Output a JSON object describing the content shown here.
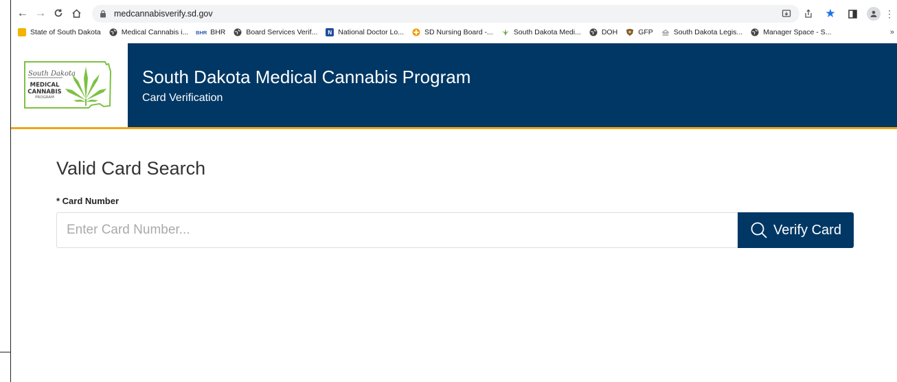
{
  "browser": {
    "url": "medcannabisverify.sd.gov",
    "bookmarks": [
      {
        "label": "State of South Dakota",
        "icon": "sd-flag-icon",
        "color": "#f2b400"
      },
      {
        "label": "Medical Cannabis i...",
        "icon": "globe-icon",
        "color": "#444444"
      },
      {
        "label": "BHR",
        "icon": "bhr-icon",
        "color": "#2a5aa8",
        "fav_text": "BHR"
      },
      {
        "label": "Board Services Verif...",
        "icon": "globe-icon",
        "color": "#444444"
      },
      {
        "label": "National Doctor Lo...",
        "icon": "n-logo-icon",
        "color": "#1f4e9c",
        "fav_text": "N"
      },
      {
        "label": "SD Nursing Board -...",
        "icon": "nursing-icon",
        "color": "#f29a00"
      },
      {
        "label": "South Dakota Medi...",
        "icon": "leaf-icon",
        "color": "#6aa84f"
      },
      {
        "label": "DOH",
        "icon": "globe-icon",
        "color": "#444444"
      },
      {
        "label": "GFP",
        "icon": "gfp-icon",
        "color": "#7a5c2e"
      },
      {
        "label": "South Dakota Legis...",
        "icon": "capitol-icon",
        "color": "#888888"
      },
      {
        "label": "Manager Space - S...",
        "icon": "globe-icon",
        "color": "#444444"
      }
    ],
    "more": "»"
  },
  "header": {
    "logo_script": "South Dakota",
    "logo_line1": "MEDICAL",
    "logo_line2": "CANNABIS",
    "logo_line3": "PROGRAM",
    "title": "South Dakota Medical Cannabis Program",
    "subtitle": "Card Verification"
  },
  "search": {
    "title": "Valid Card Search",
    "label": "* Card Number",
    "placeholder": "Enter Card Number...",
    "button_label": "Verify Card"
  },
  "colors": {
    "brand_blue": "#003764",
    "accent_gold": "#f0a516",
    "logo_green": "#7cc142"
  }
}
